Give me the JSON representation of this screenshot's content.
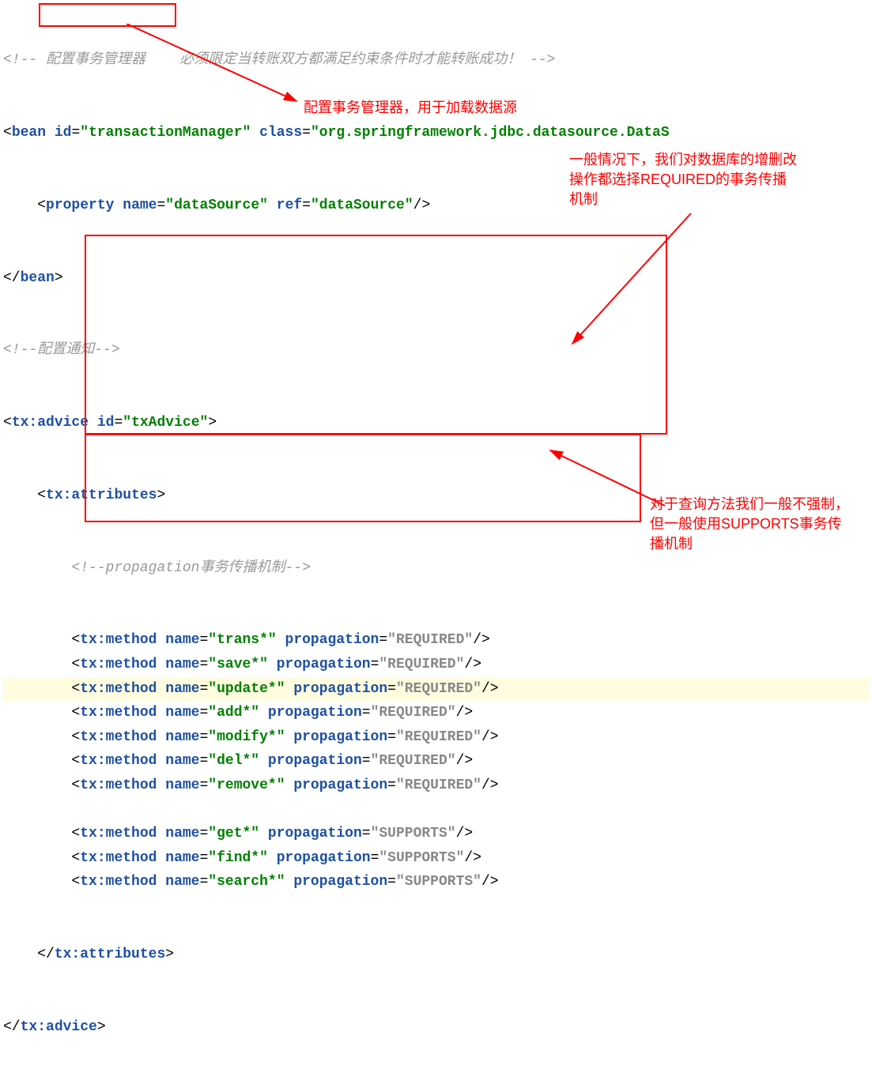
{
  "comment1_a": "配置事务管理器",
  "comment1_b": "必须限定当转账双方都满足约束条件时才能转账成功！",
  "bean": {
    "id": "transactionManager",
    "class": "org.springframework.jdbc.datasource.DataS"
  },
  "prop": {
    "name": "dataSource",
    "ref": "dataSource"
  },
  "comment2": "配置通知",
  "advice": {
    "id": "txAdvice"
  },
  "comment3": "propagation事务传播机制",
  "methods1": [
    {
      "name": "trans*",
      "prop": "REQUIRED"
    },
    {
      "name": "save*",
      "prop": "REQUIRED"
    },
    {
      "name": "update*",
      "prop": "REQUIRED"
    },
    {
      "name": "add*",
      "prop": "REQUIRED"
    },
    {
      "name": "modify*",
      "prop": "REQUIRED"
    },
    {
      "name": "del*",
      "prop": "REQUIRED"
    },
    {
      "name": "remove*",
      "prop": "REQUIRED"
    }
  ],
  "methods2": [
    {
      "name": "get*",
      "prop": "SUPPORTS"
    },
    {
      "name": "find*",
      "prop": "SUPPORTS"
    },
    {
      "name": "search*",
      "prop": "SUPPORTS"
    }
  ],
  "anno1": "配置事务管理器，用于加载数据源",
  "anno2": "一般情况下，我们对数据库的增删改操作都选择REQUIRED的事务传播机制",
  "anno3": "对于查询方法我们一般不强制，但一般使用SUPPORTS事务传播机制"
}
